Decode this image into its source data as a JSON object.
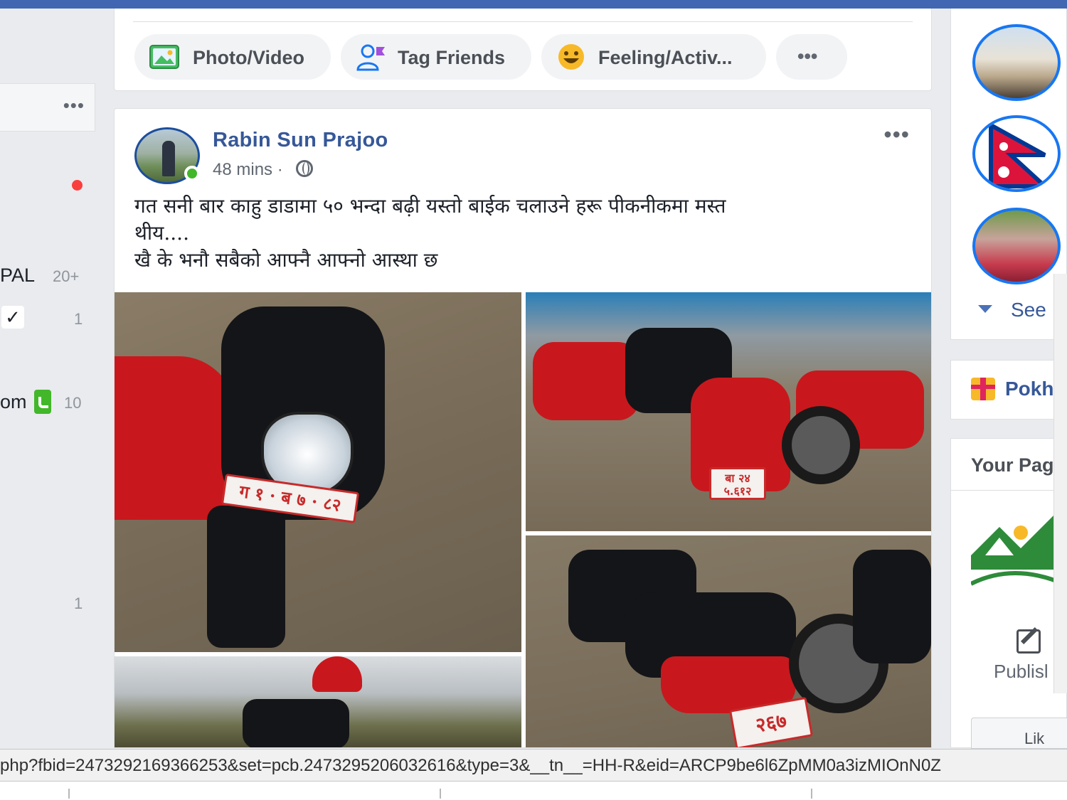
{
  "composer": {
    "photo_video": "Photo/Video",
    "tag_friends": "Tag Friends",
    "feeling": "Feeling/Activ...",
    "more": "•••"
  },
  "left_sidebar": {
    "card_more": "•••",
    "items": [
      {
        "label": "PAL",
        "count": "20+"
      },
      {
        "label": "",
        "count": "1"
      },
      {
        "label": "om",
        "count": "10"
      },
      {
        "label": "",
        "count": "1"
      }
    ]
  },
  "post": {
    "author": "Rabin Sun Prajoo",
    "time": "48 mins",
    "separator": "·",
    "more": "•••",
    "text_lines": [
      "गत सनी बार काहु डाडामा ५० भन्दा बढ़ी यस्तो बाईक चलाउने हरू पीकनीकमा मस्त",
      "थीय....",
      "खै के भनौ सबैको आफ्नै आफ्नो आस्था छ"
    ],
    "plates": {
      "photo1": "ग १ · ब ७ · ८२",
      "photo2_line1": "बा २४",
      "photo2_line2": "५.६१२",
      "photo3": "२६७"
    }
  },
  "right_sidebar": {
    "see_more": "See",
    "gift_label": "Pokh",
    "pages_title": "Your Pag",
    "publish": "Publisl",
    "like": "Lik"
  },
  "status_bar": {
    "url": "php?fbid=2473292169366253&set=pcb.2473295206032616&type=3&__tn__=HH-R&eid=ARCP9be6l6ZpMM0a3izMIOnN0Z"
  },
  "colors": {
    "brand_blue": "#4267b2",
    "link_blue": "#365899",
    "online_green": "#42b72a",
    "notification_red": "#fa3e3e"
  }
}
